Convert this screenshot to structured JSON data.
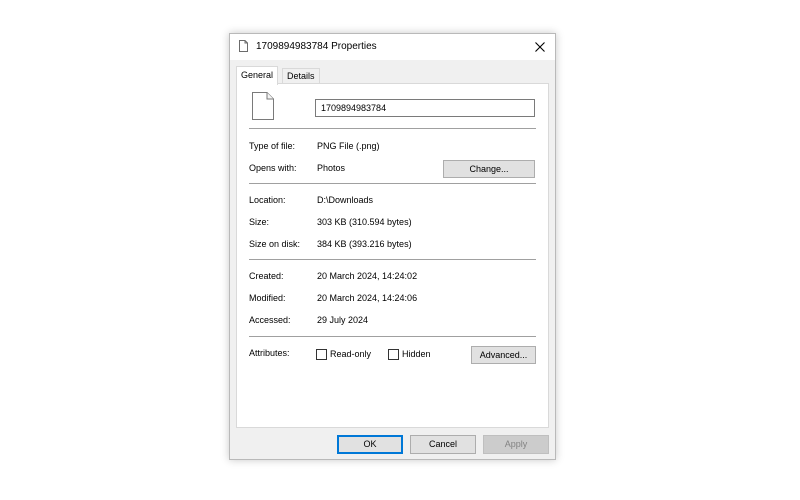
{
  "window": {
    "title": "1709894983784 Properties",
    "close_label": "×"
  },
  "tabs": [
    {
      "label": "General",
      "active": true
    },
    {
      "label": "Details",
      "active": false
    }
  ],
  "general": {
    "file_name": "1709894983784",
    "type_of_file": {
      "label": "Type of file:",
      "value": "PNG File (.png)"
    },
    "opens_with": {
      "label": "Opens with:",
      "value": "Photos",
      "change_button": "Change..."
    },
    "location": {
      "label": "Location:",
      "value": "D:\\Downloads"
    },
    "size": {
      "label": "Size:",
      "value": "303 KB (310.594 bytes)"
    },
    "size_on_disk": {
      "label": "Size on disk:",
      "value": "384 KB (393.216 bytes)"
    },
    "created": {
      "label": "Created:",
      "value": "20 March 2024, 14:24:02"
    },
    "modified": {
      "label": "Modified:",
      "value": "20 March 2024, 14:24:06"
    },
    "accessed": {
      "label": "Accessed:",
      "value": "29 July 2024"
    },
    "attributes": {
      "label": "Attributes:",
      "read_only": {
        "label": "Read-only",
        "checked": false
      },
      "hidden": {
        "label": "Hidden",
        "checked": false
      },
      "advanced_button": "Advanced..."
    }
  },
  "footer": {
    "ok": "OK",
    "cancel": "Cancel",
    "apply": "Apply"
  },
  "colors": {
    "dialog_bg": "#f0f0f0",
    "panel_bg": "#ffffff",
    "ok_border": "#0078d7",
    "button_bg": "#e1e1e1",
    "disabled_text": "#838383"
  },
  "icons": {
    "title": "document-icon",
    "close": "close-icon",
    "file": "file-icon"
  }
}
